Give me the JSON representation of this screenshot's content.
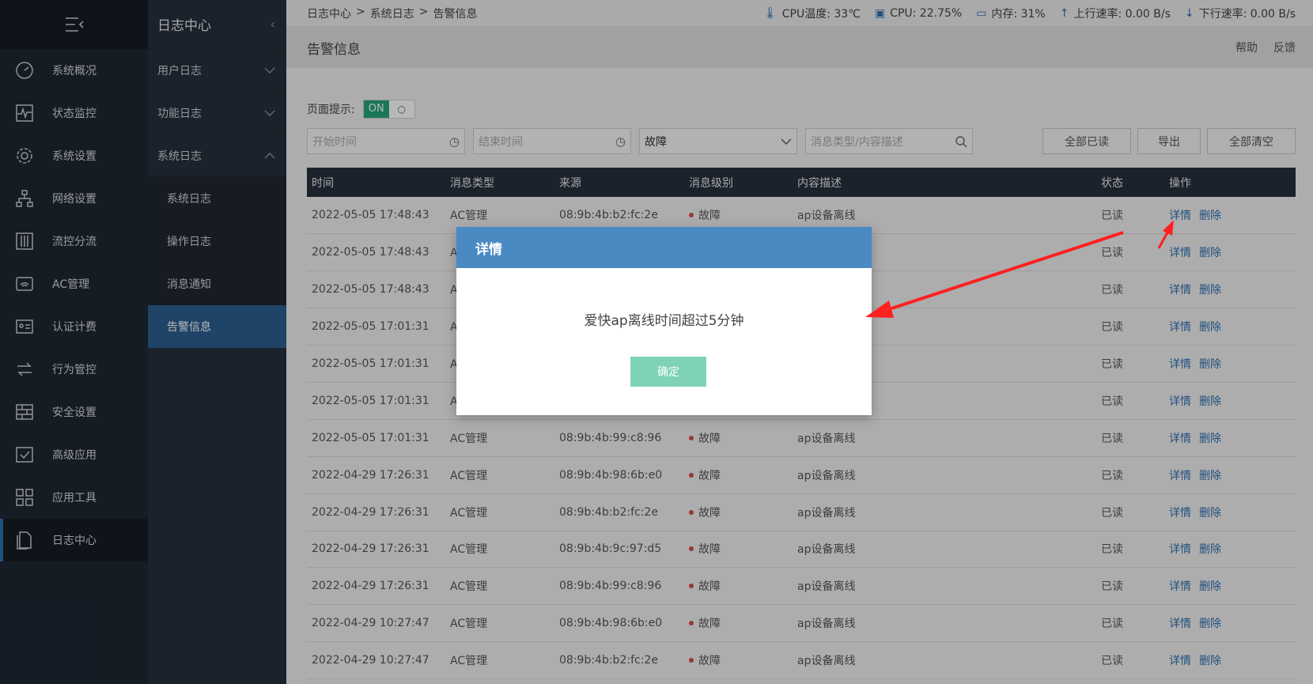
{
  "left_nav": {
    "items": [
      {
        "label": "系统概况",
        "icon": "gauge-icon"
      },
      {
        "label": "状态监控",
        "icon": "pulse-icon"
      },
      {
        "label": "系统设置",
        "icon": "gear-icon"
      },
      {
        "label": "网络设置",
        "icon": "network-icon"
      },
      {
        "label": "流控分流",
        "icon": "sliders-icon"
      },
      {
        "label": "AC管理",
        "icon": "router-icon"
      },
      {
        "label": "认证计费",
        "icon": "id-card-icon"
      },
      {
        "label": "行为管控",
        "icon": "swap-icon"
      },
      {
        "label": "安全设置",
        "icon": "firewall-icon"
      },
      {
        "label": "高级应用",
        "icon": "checkbox-icon"
      },
      {
        "label": "应用工具",
        "icon": "apps-icon"
      },
      {
        "label": "日志中心",
        "icon": "document-icon"
      }
    ],
    "active_index": 11
  },
  "sub_nav": {
    "title": "日志中心",
    "groups": [
      {
        "label": "用户日志"
      },
      {
        "label": "功能日志"
      },
      {
        "label": "系统日志"
      }
    ],
    "subitems": [
      {
        "label": "系统日志"
      },
      {
        "label": "操作日志"
      },
      {
        "label": "消息通知"
      },
      {
        "label": "告警信息"
      }
    ]
  },
  "topbar": {
    "breadcrumb": [
      "日志中心",
      ">",
      "系统日志",
      ">",
      "告警信息"
    ],
    "cpu_temp": "CPU温度: 33℃",
    "cpu": "CPU: 22.75%",
    "memory": "内存: 31%",
    "upload": "上行速率: 0.00 B/s",
    "download": "下行速率: 0.00 B/s"
  },
  "page": {
    "title": "告警信息",
    "help": "帮助",
    "feedback": "反馈"
  },
  "hint": {
    "label": "页面提示:",
    "on": "ON"
  },
  "filters": {
    "start_placeholder": "开始时间",
    "end_placeholder": "结束时间",
    "level_selected": "故障",
    "search_placeholder": "消息类型/内容描述",
    "mark_all_read": "全部已读",
    "export": "导出",
    "clear_all": "全部清空"
  },
  "table": {
    "headers": [
      "时间",
      "消息类型",
      "来源",
      "消息级别",
      "内容描述",
      "状态",
      "操作"
    ],
    "detail_label": "详情",
    "delete_label": "删除",
    "rows": [
      {
        "time": "2022-05-05 17:48:43",
        "type": "AC管理",
        "source": "08:9b:4b:b2:fc:2e",
        "level": "故障",
        "desc": "ap设备离线",
        "status": "已读"
      },
      {
        "time": "2022-05-05 17:48:43",
        "type": "AC管理",
        "source": "",
        "level": "",
        "desc": "",
        "status": "已读"
      },
      {
        "time": "2022-05-05 17:48:43",
        "type": "AC管理",
        "source": "",
        "level": "",
        "desc": "",
        "status": "已读"
      },
      {
        "time": "2022-05-05 17:01:31",
        "type": "AC管理",
        "source": "",
        "level": "",
        "desc": "",
        "status": "已读"
      },
      {
        "time": "2022-05-05 17:01:31",
        "type": "AC管理",
        "source": "",
        "level": "",
        "desc": "",
        "status": "已读"
      },
      {
        "time": "2022-05-05 17:01:31",
        "type": "AC管理",
        "source": "",
        "level": "",
        "desc": "",
        "status": "已读"
      },
      {
        "time": "2022-05-05 17:01:31",
        "type": "AC管理",
        "source": "08:9b:4b:99:c8:96",
        "level": "故障",
        "desc": "ap设备离线",
        "status": "已读"
      },
      {
        "time": "2022-04-29 17:26:31",
        "type": "AC管理",
        "source": "08:9b:4b:98:6b:e0",
        "level": "故障",
        "desc": "ap设备离线",
        "status": "已读"
      },
      {
        "time": "2022-04-29 17:26:31",
        "type": "AC管理",
        "source": "08:9b:4b:b2:fc:2e",
        "level": "故障",
        "desc": "ap设备离线",
        "status": "已读"
      },
      {
        "time": "2022-04-29 17:26:31",
        "type": "AC管理",
        "source": "08:9b:4b:9c:97:d5",
        "level": "故障",
        "desc": "ap设备离线",
        "status": "已读"
      },
      {
        "time": "2022-04-29 17:26:31",
        "type": "AC管理",
        "source": "08:9b:4b:99:c8:96",
        "level": "故障",
        "desc": "ap设备离线",
        "status": "已读"
      },
      {
        "time": "2022-04-29 10:27:47",
        "type": "AC管理",
        "source": "08:9b:4b:98:6b:e0",
        "level": "故障",
        "desc": "ap设备离线",
        "status": "已读"
      },
      {
        "time": "2022-04-29 10:27:47",
        "type": "AC管理",
        "source": "08:9b:4b:b2:fc:2e",
        "level": "故障",
        "desc": "ap设备离线",
        "status": "已读"
      }
    ]
  },
  "modal": {
    "title": "详情",
    "message": "爱快ap离线时间超过5分钟",
    "ok": "确定"
  },
  "colors": {
    "sidebar": "#1f2733",
    "subnav": "#27303c",
    "active_subitem": "#2b5f8f",
    "modal_header": "#4a8ac3",
    "ok_button": "#7fd3b5",
    "switch_on": "#27a67a",
    "link": "#2f6fb0",
    "fault_dot": "#d94a4a",
    "annotation_arrow": "#ff2020"
  }
}
